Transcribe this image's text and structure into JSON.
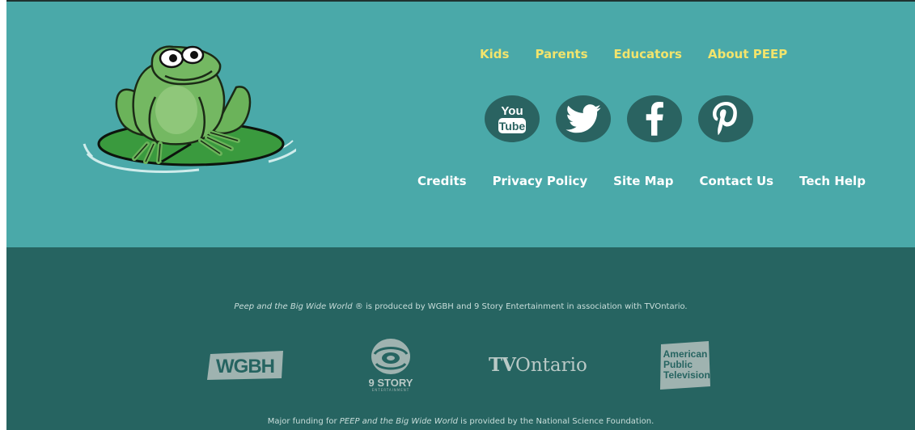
{
  "primary_nav": {
    "kids": "Kids",
    "parents": "Parents",
    "educators": "Educators",
    "about": "About PEEP"
  },
  "social_icons": [
    "youtube-icon",
    "twitter-icon",
    "facebook-icon",
    "pinterest-icon"
  ],
  "youtube_icon_text": {
    "top": "You",
    "bottom": "Tube"
  },
  "secondary_nav": {
    "credits": "Credits",
    "privacy": "Privacy Policy",
    "sitemap": "Site Map",
    "contact": "Contact Us",
    "techhelp": "Tech Help"
  },
  "credits_text": {
    "produced_title": "Peep and the Big Wide World ®",
    "produced_rest": " is produced by WGBH and 9 Story Entertainment in association with TVOntario.",
    "funding_prefix": "Major funding for ",
    "funding_title": "PEEP and the Big Wide World",
    "funding_rest": " is provided by the National Science Foundation."
  },
  "partner_logos": {
    "wgbh": "WGBH",
    "nine_story": "9 STORY",
    "nine_story_sub": "ENTERTAINMENT",
    "tvo_bold": "TV",
    "tvo_rest": "Ontario",
    "apt_line1": "American",
    "apt_line2": "Public",
    "apt_line3": "Television"
  },
  "colors": {
    "top_bg": "#4aa9a9",
    "bottom_bg": "#266461",
    "primary_link": "#f2e46c",
    "secondary_link": "#ffffff",
    "social_circle": "#2a6361"
  }
}
